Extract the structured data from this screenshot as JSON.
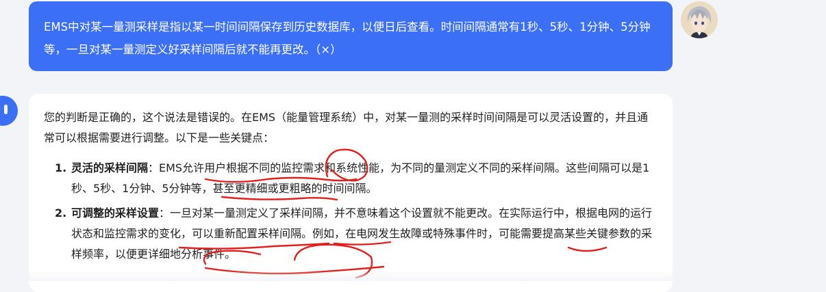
{
  "user_message": {
    "text": "EMS中对某一量测采样是指以某一时间间隔保存到历史数据库，以便日后查看。时间间隔通常有1秒、5秒、1分钟、5分钟等，一旦对某一量测定义好采样间隔后就不能再更改。（×）"
  },
  "user_avatar": {
    "icon": "anime-character-avatar"
  },
  "assistant_avatar": {
    "icon": "bot-face-icon",
    "color": "#3b6ff5"
  },
  "assistant_message": {
    "intro": "您的判断是正确的，这个说法是错误的。在EMS（能量管理系统）中，对某一量测的采样时间间隔是可以灵活设置的，并且通常可以根据需要进行调整。以下是一些关键点：",
    "points": [
      {
        "num": "1.",
        "title": "灵活的采样间隔",
        "text": "：EMS允许用户根据不同的监控需求和系统性能，为不同的量测定义不同的采样间隔。这些间隔可以是1秒、5秒、1分钟、5分钟等，甚至更精细或更粗略的时间间隔。"
      },
      {
        "num": "2.",
        "title": "可调整的采样设置",
        "text": "：一旦对某一量测定义了采样间隔，并不意味着这个设置就不能更改。在实际运行中，根据电网的运行状态和监控需求的变化，可以重新配置采样间隔。例如，在电网发生故障或特殊事件时，可能需要提高某些关键参数的采样频率，以便更详细地分析事件。"
      }
    ]
  },
  "colors": {
    "user_bubble": "#3b6ff5",
    "page_bg": "#f3f4f8",
    "annotation_red": "#e0201c"
  }
}
